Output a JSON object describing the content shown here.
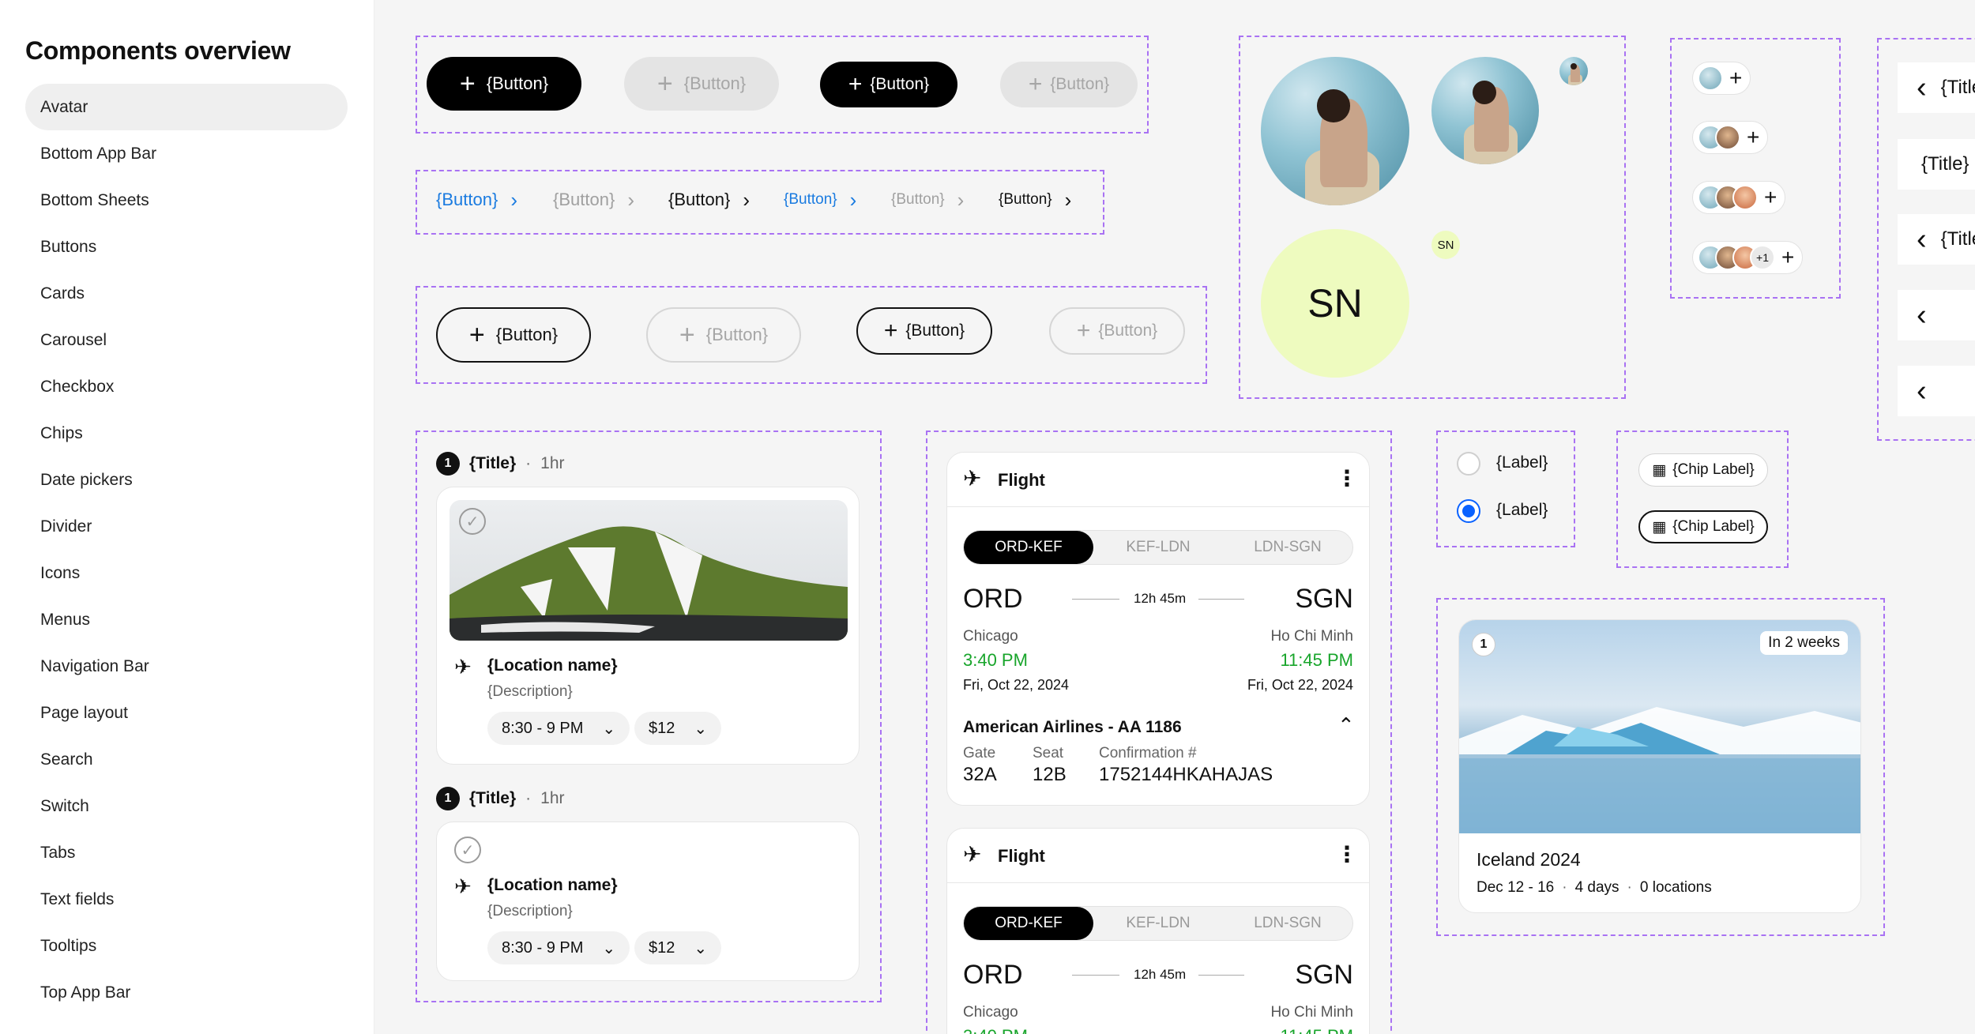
{
  "sidebar": {
    "title": "Components overview",
    "items": [
      "Avatar",
      "Bottom App Bar",
      "Bottom Sheets",
      "Buttons",
      "Cards",
      "Carousel",
      "Checkbox",
      "Chips",
      "Date pickers",
      "Divider",
      "Icons",
      "Menus",
      "Navigation Bar",
      "Page layout",
      "Search",
      "Switch",
      "Tabs",
      "Text fields",
      "Tooltips",
      "Top App Bar"
    ],
    "active": "Avatar"
  },
  "buttons": {
    "label": "{Button}",
    "plus": "+"
  },
  "breadcrumb": {
    "label": "{Button}",
    "chevron": "›",
    "link_color": "#1a7be0"
  },
  "avatars": {
    "initials": "SN",
    "overflow_count": "+1",
    "add": "+"
  },
  "app_bar": {
    "title": "{Title}",
    "back": "‹"
  },
  "itinerary": {
    "items": [
      {
        "index": "1",
        "title": "{Title}",
        "duration": "1hr",
        "location": "{Location name}",
        "description": "{Description}",
        "time": "8:30 - 9 PM",
        "price": "$12"
      },
      {
        "index": "1",
        "title": "{Title}",
        "duration": "1hr",
        "location": "{Location name}",
        "description": "{Description}",
        "time": "8:30 - 9 PM",
        "price": "$12"
      }
    ],
    "separator": "·"
  },
  "flight": {
    "title": "Flight",
    "segments": [
      "ORD-KEF",
      "KEF-LDN",
      "LDN-SGN"
    ],
    "from_code": "ORD",
    "to_code": "SGN",
    "duration": "12h 45m",
    "from_city": "Chicago",
    "to_city": "Ho Chi Minh",
    "depart_time": "3:40 PM",
    "arrive_time": "11:45 PM",
    "depart_date": "Fri, Oct 22, 2024",
    "arrive_date": "Fri, Oct 22, 2024",
    "airline": "American Airlines - AA 1186",
    "gate_label": "Gate",
    "gate": "32A",
    "seat_label": "Seat",
    "seat": "12B",
    "conf_label": "Confirmation #",
    "confirmation": "1752144HKAHAJAS",
    "partial_depart": "3:40 PM",
    "partial_arrive": "11:45 PM"
  },
  "radios": {
    "label": "{Label}"
  },
  "chips": {
    "label": "{Chip Label}"
  },
  "trip": {
    "index": "1",
    "badge": "In 2 weeks",
    "title": "Iceland 2024",
    "dates": "Dec 12 - 16",
    "days": "4 days",
    "locations": "0 locations",
    "separator": "·"
  },
  "colors": {
    "accent": "#a972f3",
    "green": "#18a52b",
    "link": "#1a7be0",
    "radio": "#0a62ff",
    "avatar_bg": "#eefbbf"
  },
  "icons": [
    "plus-icon",
    "chevron-right-icon",
    "chevron-down-icon",
    "chevron-up-icon",
    "chevron-left-icon",
    "plane-icon",
    "more-vertical-icon",
    "check-circle-icon",
    "calendar-icon",
    "arrow-right-icon"
  ]
}
